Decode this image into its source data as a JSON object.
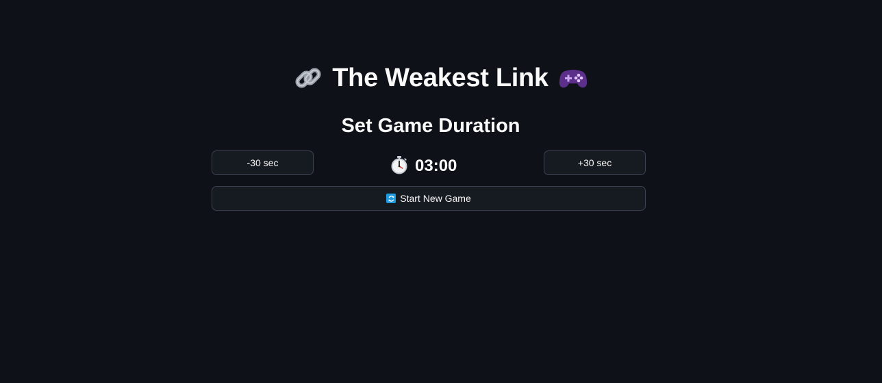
{
  "header": {
    "title": "The Weakest Link",
    "leading_icon": "link-icon",
    "trailing_icon": "game-controller-icon"
  },
  "duration": {
    "heading": "Set Game Duration",
    "decrease_label": "-30 sec",
    "increase_label": "+30 sec",
    "timer_icon": "stopwatch-icon",
    "value": "03:00"
  },
  "actions": {
    "start_label": "Start New Game",
    "start_icon": "refresh-icon"
  },
  "colors": {
    "background": "#0e1117",
    "button_background": "#161a21",
    "button_border": "#3d4150",
    "text": "#fafafa"
  }
}
